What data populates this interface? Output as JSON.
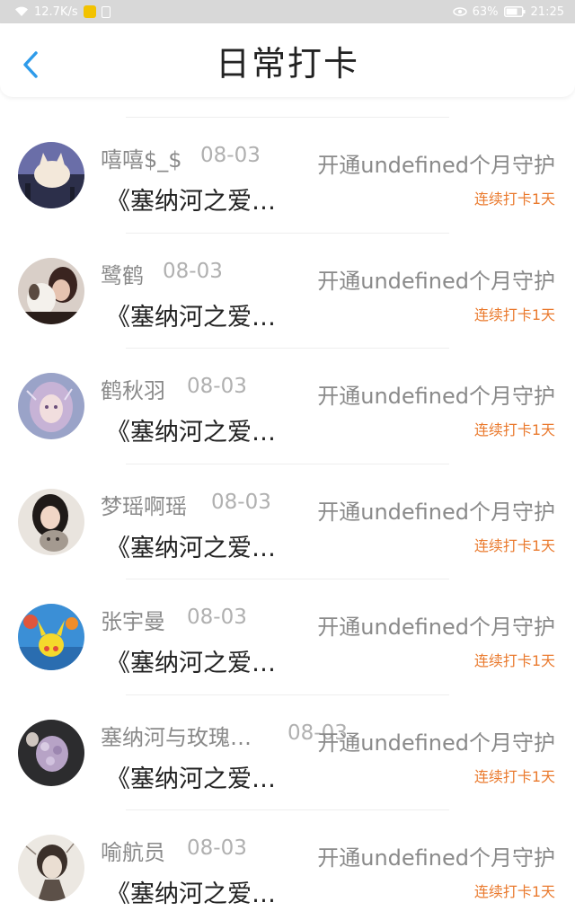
{
  "status_bar": {
    "speed": "12.7K/s",
    "battery_pct": "63%",
    "time": "21:25"
  },
  "header": {
    "title": "日常打卡",
    "back_icon": "chevron-left-icon"
  },
  "colors": {
    "accent_blue": "#2e9bea",
    "streak_orange": "#ea7a2e",
    "text_gray": "#8a8a8a"
  },
  "items": [
    {
      "name": "嘻嘻$_$",
      "date": "08-03",
      "content": "《塞纳河之爱…",
      "guard": "开通undefined个月守护",
      "streak": "连续打卡1天",
      "avatar": "avatar-cat-sky"
    },
    {
      "name": "鹭鹤",
      "date": "08-03",
      "content": "《塞纳河之爱…",
      "guard": "开通undefined个月守护",
      "streak": "连续打卡1天",
      "avatar": "avatar-girl-dog"
    },
    {
      "name": "鹤秋羽",
      "date": "08-03",
      "content": "《塞纳河之爱…",
      "guard": "开通undefined个月守护",
      "streak": "连续打卡1天",
      "avatar": "avatar-anime-girl"
    },
    {
      "name": "梦瑶啊瑶",
      "date": "08-03",
      "content": "《塞纳河之爱…",
      "guard": "开通undefined个月守护",
      "streak": "连续打卡1天",
      "avatar": "avatar-girl-cat"
    },
    {
      "name": "张宇曼",
      "date": "08-03",
      "content": "《塞纳河之爱…",
      "guard": "开通undefined个月守护",
      "streak": "连续打卡1天",
      "avatar": "avatar-pikachu"
    },
    {
      "name": "塞纳河与玫瑰…",
      "date": "08-03",
      "content": "《塞纳河之爱…",
      "guard": "开通undefined个月守护",
      "streak": "连续打卡1天",
      "avatar": "avatar-flowers"
    },
    {
      "name": "喻航员",
      "date": "08-03",
      "content": "《塞纳河之爱…",
      "guard": "开通undefined个月守护",
      "streak": "连续打卡1天",
      "avatar": "avatar-sketch-boy"
    }
  ]
}
